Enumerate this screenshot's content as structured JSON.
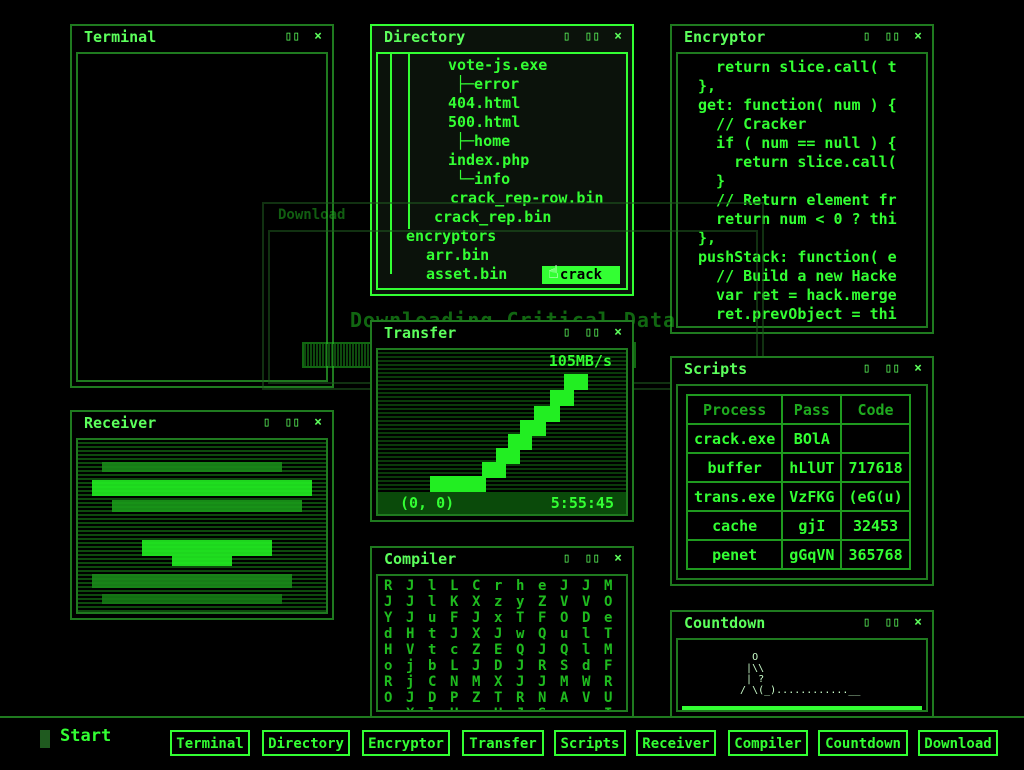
{
  "windows": {
    "terminal": {
      "title": "Terminal"
    },
    "directory": {
      "title": "Directory",
      "lines": [
        "vote-js.exe",
        "├─error",
        "404.html",
        "500.html",
        "├─home",
        "index.php",
        "└─info",
        "crack_rep-row.bin",
        "crack_rep.bin",
        "encryptors",
        "arr.bin",
        "asset.bin"
      ],
      "crack_button": "crack"
    },
    "encryptor": {
      "title": "Encryptor",
      "code": [
        "  return slice.call( t",
        "},",
        "get: function( num ) {",
        "  // Cracker",
        "  if ( num == null ) {",
        "    return slice.call(",
        "  }",
        "  // Return element fr",
        "  return num < 0 ? thi",
        "},",
        "pushStack: function( e",
        "  // Build a new Hacke",
        "  var ret = hack.merge",
        "  ret.prevObject = thi"
      ]
    },
    "download": {
      "title": "Download",
      "text": "Downloading Critical Data"
    },
    "transfer": {
      "title": "Transfer",
      "speed": "105MB/s",
      "coords": "(0, 0)",
      "time": "5:55:45"
    },
    "scripts": {
      "title": "Scripts",
      "headers": [
        "Process",
        "Pass",
        "Code"
      ],
      "rows": [
        [
          "crack.exe",
          "BOlA",
          ""
        ],
        [
          "buffer",
          "hLlUT",
          "717618"
        ],
        [
          "trans.exe",
          "VzFKG",
          "(eG(u)"
        ],
        [
          "cache",
          "gjI",
          "32453"
        ],
        [
          "penet",
          "gGqVN",
          "365768"
        ]
      ]
    },
    "receiver": {
      "title": "Receiver"
    },
    "compiler": {
      "title": "Compiler",
      "columns": [
        "RJYdHoROyh",
        "JJJHVjjJXxa",
        "lluttbCDlp",
        "LKFJcLNPUN",
        "CXJXZJMZoI",
        "rzxJEDXTU",
        "hyTwQJJRJNS",
        "eZFQJRJNS",
        "JVOuQSMAsxe",
        "JVDlldWVv",
        "MOeTMFRUIDt"
      ]
    },
    "countdown": {
      "title": "Countdown",
      "art": "    O\n   |\\\\\n   | ?\n  / \\(_)............__"
    }
  },
  "taskbar": {
    "start": "Start",
    "buttons": [
      "Terminal",
      "Directory",
      "Encryptor",
      "Transfer",
      "Scripts",
      "Receiver",
      "Compiler",
      "Countdown",
      "Download"
    ]
  },
  "colors": {
    "primary": "#33ff33",
    "dim": "#1f7a1f",
    "bg": "#000000"
  }
}
